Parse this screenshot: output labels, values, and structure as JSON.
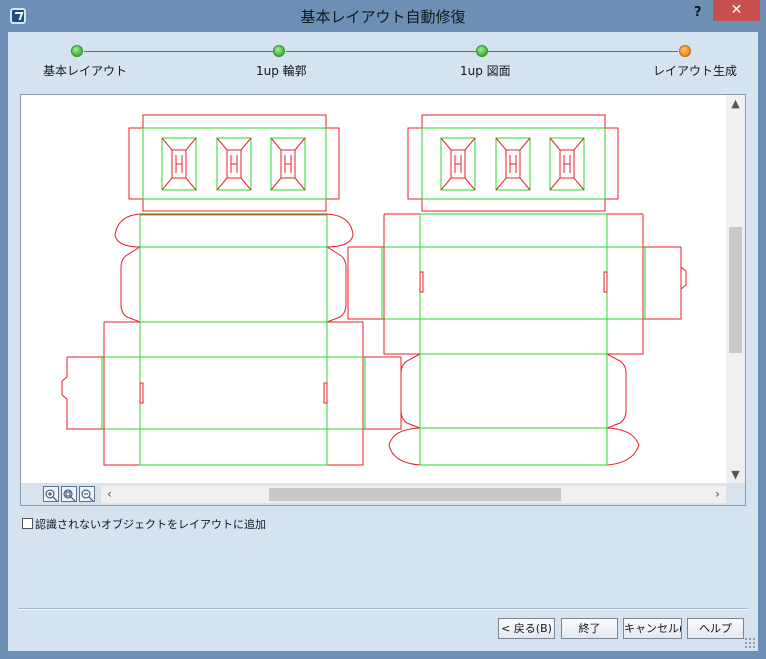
{
  "window": {
    "title": "基本レイアウト自動修復",
    "help_label": "?",
    "close_label": "✕"
  },
  "steps": [
    {
      "label": "基本レイアウト",
      "state": "done"
    },
    {
      "label": "1up 輪郭",
      "state": "done"
    },
    {
      "label": "1up 図面",
      "state": "done"
    },
    {
      "label": "レイアウト生成",
      "state": "current"
    }
  ],
  "colors": {
    "cut_line": "#e8202a",
    "crease_line": "#28d82e",
    "step_done": "#3fb23a",
    "step_current": "#f08a1a"
  },
  "checkbox": {
    "label": "認識されないオブジェクトをレイアウトに追加",
    "checked": false
  },
  "zoom_tools": [
    "zoom-in-icon",
    "zoom-fit-icon",
    "zoom-out-icon"
  ],
  "buttons": {
    "back": "< 戻る(B)",
    "finish": "終了",
    "cancel": "キャンセル(C)",
    "help": "ヘルプ"
  }
}
